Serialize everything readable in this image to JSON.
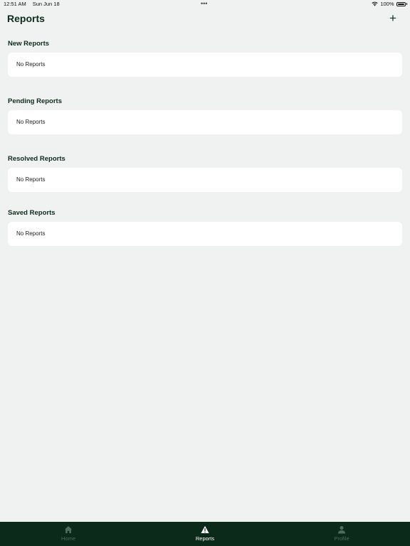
{
  "status_bar": {
    "time": "12:51 AM",
    "date": "Sun Jun 18",
    "battery": "100%"
  },
  "header": {
    "title": "Reports",
    "add_label": "+"
  },
  "sections": [
    {
      "title": "New Reports",
      "empty_text": "No Reports"
    },
    {
      "title": "Pending Reports",
      "empty_text": "No Reports"
    },
    {
      "title": "Resolved Reports",
      "empty_text": "No Reports"
    },
    {
      "title": "Saved Reports",
      "empty_text": "No Reports"
    }
  ],
  "tab_bar": {
    "tabs": [
      {
        "label": "Home",
        "icon": "home-icon",
        "active": false
      },
      {
        "label": "Reports",
        "icon": "warning-icon",
        "active": true
      },
      {
        "label": "Profile",
        "icon": "person-icon",
        "active": false
      }
    ],
    "active_color": "#ffffff",
    "inactive_color": "#4f6b5c",
    "background": "#0b2a1a"
  }
}
